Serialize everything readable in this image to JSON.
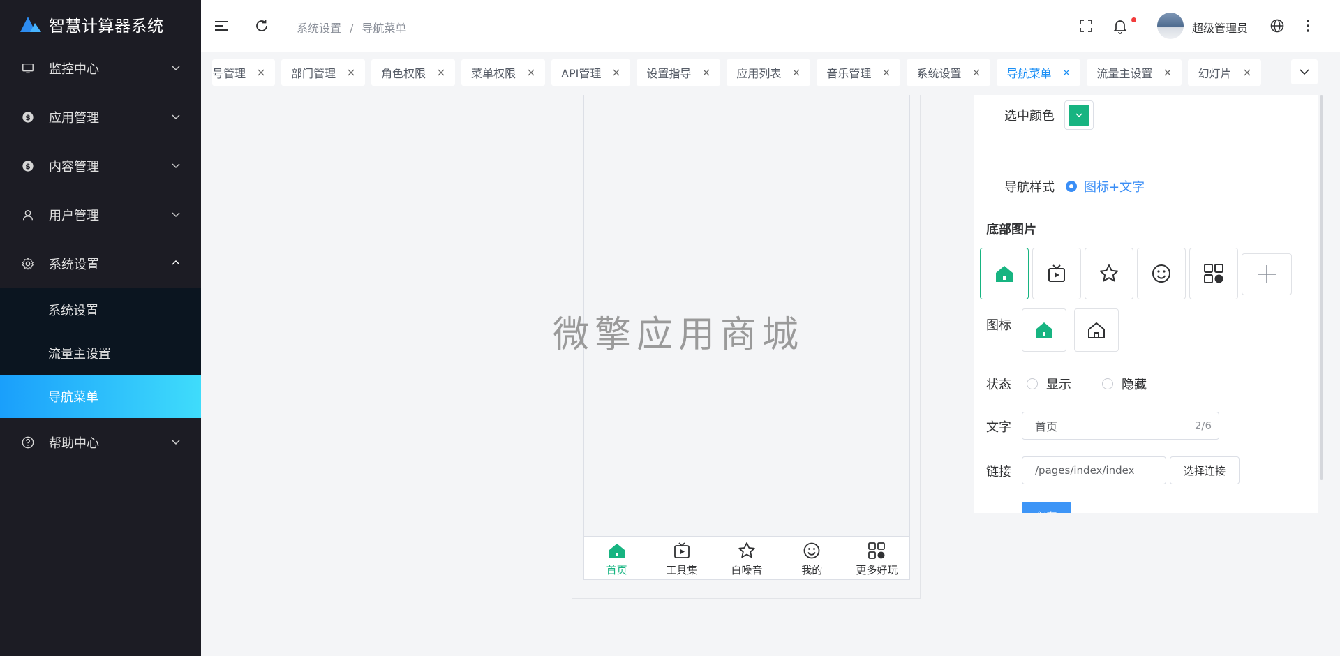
{
  "app": {
    "title": "智慧计算器系统",
    "brand_color": "#2d8cf0"
  },
  "sidebar": {
    "items": [
      {
        "label": "监控中心",
        "icon": "monitor-icon"
      },
      {
        "label": "应用管理",
        "icon": "dollar-circle-icon"
      },
      {
        "label": "内容管理",
        "icon": "dollar-circle-icon"
      },
      {
        "label": "用户管理",
        "icon": "user-icon"
      },
      {
        "label": "系统设置",
        "icon": "gear-icon",
        "expanded": true
      },
      {
        "label": "帮助中心",
        "icon": "help-circle-icon"
      }
    ],
    "sub_items": [
      {
        "label": "系统设置"
      },
      {
        "label": "流量主设置"
      },
      {
        "label": "导航菜单",
        "active": true
      }
    ]
  },
  "header": {
    "breadcrumb": [
      "系统设置",
      "导航菜单"
    ],
    "breadcrumb_separator": "/",
    "username": "超级管理员"
  },
  "tabs": [
    {
      "label": "账号管理",
      "visible_label": "号管理"
    },
    {
      "label": "部门管理"
    },
    {
      "label": "角色权限"
    },
    {
      "label": "菜单权限"
    },
    {
      "label": "API管理"
    },
    {
      "label": "设置指导"
    },
    {
      "label": "应用列表"
    },
    {
      "label": "音乐管理"
    },
    {
      "label": "系统设置"
    },
    {
      "label": "导航菜单",
      "active": true
    },
    {
      "label": "流量主设置"
    },
    {
      "label": "幻灯片"
    }
  ],
  "preview": {
    "watermark": "微擎应用商城",
    "bottom_nav": [
      {
        "label": "首页",
        "icon": "home-icon",
        "active": true
      },
      {
        "label": "工具集",
        "icon": "tv-play-icon"
      },
      {
        "label": "白噪音",
        "icon": "star-icon"
      },
      {
        "label": "我的",
        "icon": "smile-icon"
      },
      {
        "label": "更多好玩",
        "icon": "grid-icon"
      }
    ],
    "active_color": "#17b481"
  },
  "settings": {
    "selected_color_label": "选中颜色",
    "selected_color": "#17b481",
    "nav_style_label": "导航样式",
    "nav_style_option": "图标+文字",
    "bottom_images_label": "底部图片",
    "icon_label": "图标",
    "status_label": "状态",
    "status_show": "显示",
    "status_hide": "隐藏",
    "text_label": "文字",
    "text_value": "首页",
    "text_counter": "2/6",
    "link_label": "链接",
    "link_value": "/pages/index/index",
    "choose_link_button": "选择连接",
    "save_button": "保存"
  }
}
